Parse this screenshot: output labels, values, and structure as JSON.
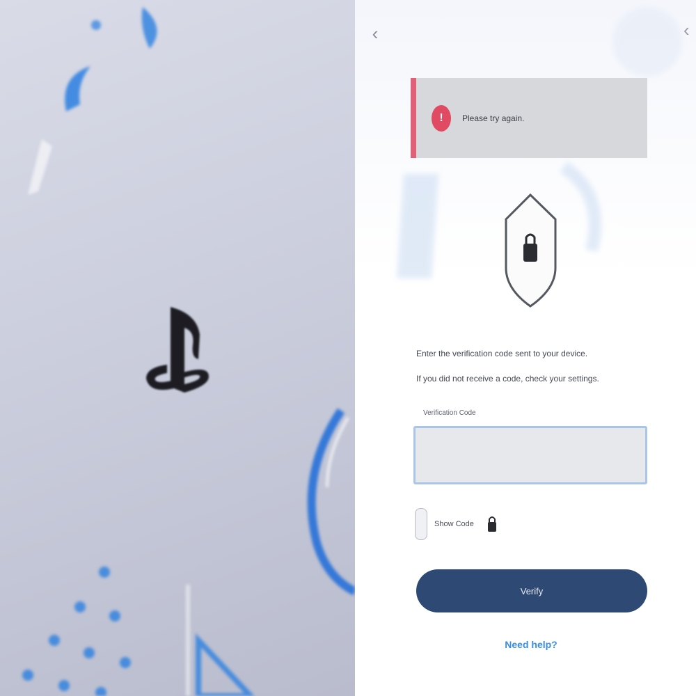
{
  "left_panel": {
    "logo_name": "playstation-logo"
  },
  "header": {
    "back_glyph": "‹",
    "corner_glyph": "‹"
  },
  "error": {
    "icon_glyph": "!",
    "message": "Please try again."
  },
  "security": {
    "shield_icon": "shield-lock-icon"
  },
  "instructions": {
    "line1": "Enter the verification code sent to your device.",
    "line2": "If you did not receive a code, check your settings."
  },
  "form": {
    "field_label": "Verification Code",
    "input_value": "",
    "input_placeholder": "",
    "show_toggle_label": "Show Code",
    "submit_label": "Verify"
  },
  "footer": {
    "help_link": "Need help?"
  },
  "colors": {
    "accent_blue": "#3a8ee0",
    "button_navy": "#2e4a74",
    "error_red": "#e04a62",
    "error_border": "#e0607a"
  }
}
